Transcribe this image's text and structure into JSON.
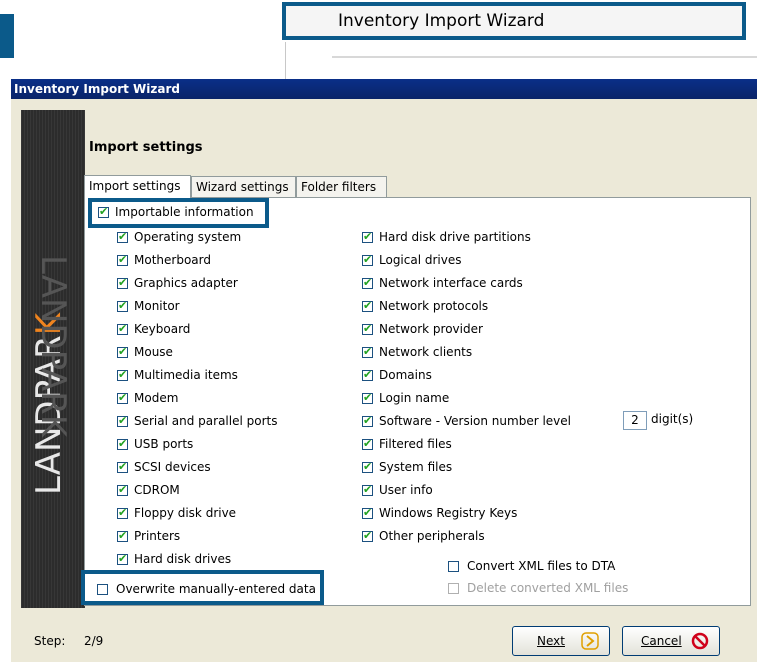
{
  "zoom": {
    "title": "Inventory Import Wizard"
  },
  "window": {
    "title": "Inventory Import Wizard"
  },
  "logo": {
    "text_main": "LANDPAR",
    "text_accent": "K"
  },
  "page": {
    "heading": "Import settings"
  },
  "tabs": [
    {
      "label": "Import settings",
      "active": true
    },
    {
      "label": "Wizard settings",
      "active": false
    },
    {
      "label": "Folder filters",
      "active": false
    }
  ],
  "importable": {
    "label": "Importable information",
    "checked": true
  },
  "left_options": [
    "Operating system",
    "Motherboard",
    "Graphics adapter",
    "Monitor",
    "Keyboard",
    "Mouse",
    "Multimedia items",
    "Modem",
    "Serial and parallel ports",
    "USB ports",
    "SCSI devices",
    "CDROM",
    "Floppy disk drive",
    "Printers",
    "Hard disk drives"
  ],
  "right_options": [
    "Hard disk drive partitions",
    "Logical drives",
    "Network interface cards",
    "Network protocols",
    "Network provider",
    "Network clients",
    "Domains",
    "Login name",
    "Software -  Version number level",
    "Filtered files",
    "System files",
    "User info",
    "Windows Registry Keys",
    "Other peripherals"
  ],
  "version_level": {
    "value": "2",
    "unit": "digit(s)"
  },
  "convert_xml": {
    "label": "Convert XML files to DTA",
    "checked": false
  },
  "delete_xml": {
    "label": "Delete converted XML files",
    "checked": false,
    "disabled": true
  },
  "overwrite": {
    "label": "Overwrite manually-entered data",
    "checked": false
  },
  "footer": {
    "step_label": "Step:",
    "step_value": "2/9",
    "next_label": "Next",
    "cancel_label": "Cancel"
  },
  "colors": {
    "highlight": "#0b5a8a",
    "titlebar": "#0a2f88",
    "check": "#21a121",
    "cancel_icon": "#d0021b",
    "next_icon": "#e0a000"
  }
}
